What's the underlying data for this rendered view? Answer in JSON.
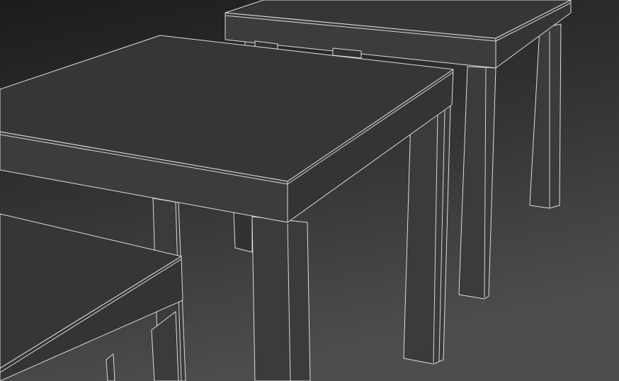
{
  "scene": {
    "description_free": true,
    "colors": {
      "background_top": "#1e1e1e",
      "background_bottom": "#4a4a4a",
      "wireframe_edge": "#dcdcdc",
      "surface": "#383838"
    },
    "objects": [
      {
        "name": "table-back-right"
      },
      {
        "name": "table-center"
      },
      {
        "name": "table-front-left"
      }
    ]
  }
}
